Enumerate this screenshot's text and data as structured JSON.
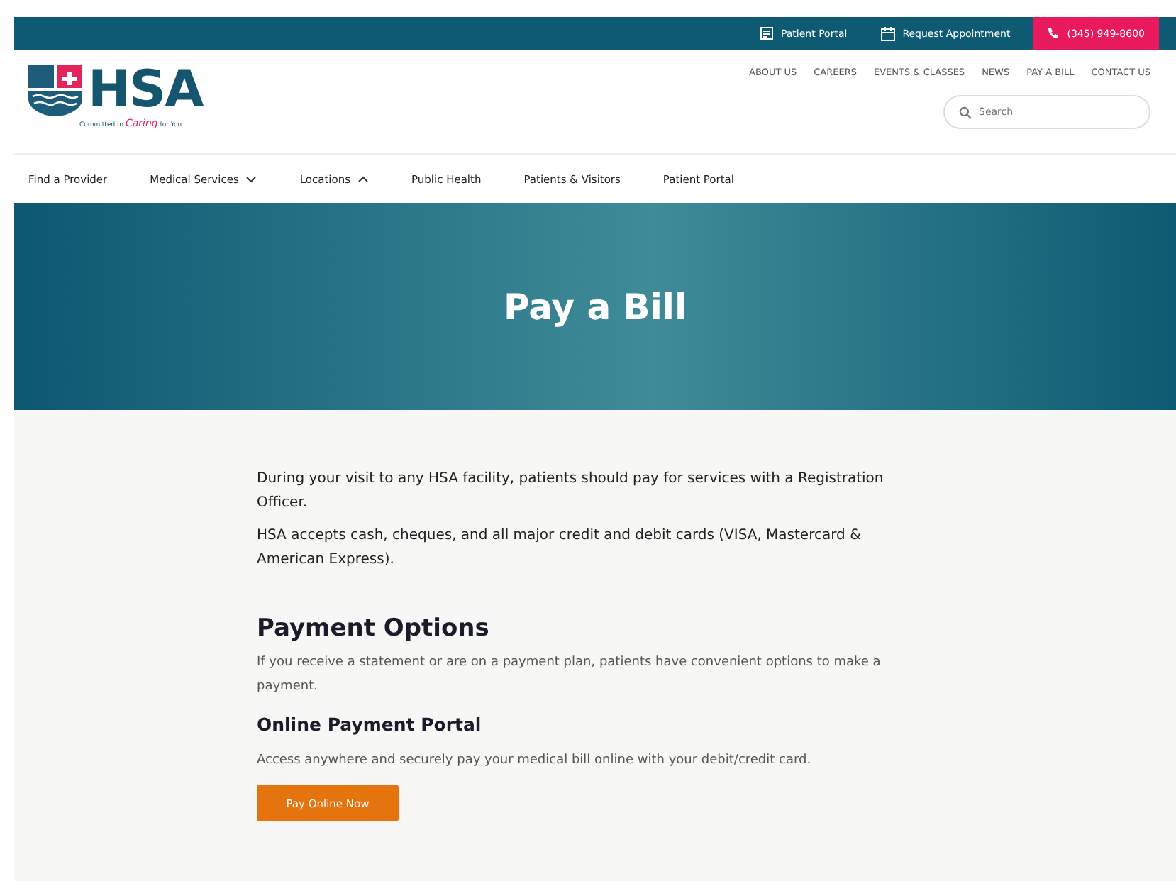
{
  "top_bar": {
    "links": [
      {
        "kind": "portal",
        "label": "Patient Portal"
      },
      {
        "kind": "calendar",
        "label": "Request Appointment"
      },
      {
        "kind": "phone",
        "label": "(345) 949-8600"
      }
    ]
  },
  "logo": {
    "text": "HSA",
    "tagline_before": "Committed to ",
    "tagline_script": "Caring",
    "tagline_after": " for You"
  },
  "secondary_nav": [
    "ABOUT US",
    "CAREERS",
    "EVENTS & CLASSES",
    "NEWS",
    "PAY A BILL",
    "CONTACT US"
  ],
  "search": {
    "placeholder": "Search"
  },
  "main_nav": [
    {
      "label": "Find a Provider"
    },
    {
      "label": "Medical Services",
      "expanded": false
    },
    {
      "label": "Locations",
      "expanded": true
    },
    {
      "label": "Public Health"
    },
    {
      "label": "Patients & Visitors"
    },
    {
      "label": "Patient Portal"
    }
  ],
  "hero": {
    "title": "Pay a Bill"
  },
  "content": [
    {
      "kind": "paragraph",
      "text": "During your visit to any HSA facility, patients should pay for services with a Registration Officer."
    },
    {
      "kind": "paragraph",
      "text": "HSA accepts cash, cheques, and all major credit and debit cards (VISA, Mastercard & American Express)."
    },
    {
      "kind": "heading",
      "text": "Payment Options"
    },
    {
      "kind": "note",
      "text": "If you receive a statement or are on a payment plan, patients have convenient options to make a payment."
    },
    {
      "kind": "subheading",
      "text": "Online Payment Portal"
    },
    {
      "kind": "note",
      "text": "Access anywhere and securely pay your medical bill online with your debit/credit card."
    },
    {
      "kind": "button",
      "text": "Pay Online Now"
    }
  ]
}
